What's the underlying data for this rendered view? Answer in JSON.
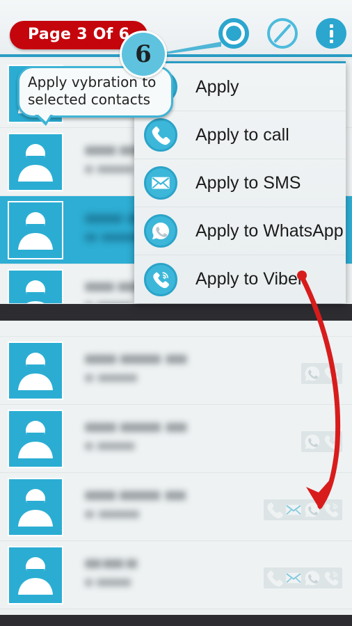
{
  "app": {
    "page_indicator": "Page 3 Of 6",
    "step_number": "6",
    "accent_blue": "#2ba6cf",
    "avatar_blue": "#2badd3",
    "selected_row_blue": "#2eaed4",
    "badge_red": "#c5050c",
    "band_dark": "#2c2c31"
  },
  "actionbar": {
    "icons": [
      {
        "name": "vibration-target-icon",
        "label": "Vibration"
      },
      {
        "name": "no-entry-icon",
        "label": "Silent"
      },
      {
        "name": "overflow-menu-icon",
        "label": "More options"
      }
    ]
  },
  "callout": {
    "text": "Apply vybration to\nselected contacts"
  },
  "menu": {
    "items": [
      {
        "label": "Apply",
        "icon": "people-group-icon"
      },
      {
        "label": "Apply to call",
        "icon": "phone-icon"
      },
      {
        "label": "Apply to SMS",
        "icon": "envelope-icon"
      },
      {
        "label": "Apply to WhatsApp",
        "icon": "whatsapp-icon"
      },
      {
        "label": "Apply to Viber",
        "icon": "viber-icon"
      }
    ]
  },
  "top_list": {
    "rows": [
      {
        "name": "",
        "number": "",
        "selected": false,
        "actions": []
      },
      {
        "name": "",
        "number": "",
        "selected": false,
        "actions": []
      },
      {
        "name": "",
        "number": "",
        "selected": true,
        "actions": []
      },
      {
        "name": "",
        "number": "",
        "selected": false,
        "actions": []
      }
    ]
  },
  "bottom_list": {
    "rows": [
      {
        "name": "",
        "number": "",
        "selected": false,
        "actions": [
          "whatsapp-icon",
          "viber-icon"
        ]
      },
      {
        "name": "",
        "number": "",
        "selected": false,
        "actions": [
          "whatsapp-icon",
          "viber-icon"
        ]
      },
      {
        "name": "",
        "number": "",
        "selected": false,
        "actions": [
          "phone-icon",
          "envelope-icon",
          "whatsapp-icon",
          "viber-icon"
        ]
      },
      {
        "name": "",
        "number": "",
        "selected": false,
        "actions": [
          "phone-icon",
          "envelope-icon",
          "whatsapp-icon",
          "viber-icon"
        ]
      }
    ]
  },
  "annotation": {
    "arrow_color": "#d81c1c",
    "arrow_from": "Apply to Viber",
    "arrow_to": "contact-row-3-viber-action"
  }
}
